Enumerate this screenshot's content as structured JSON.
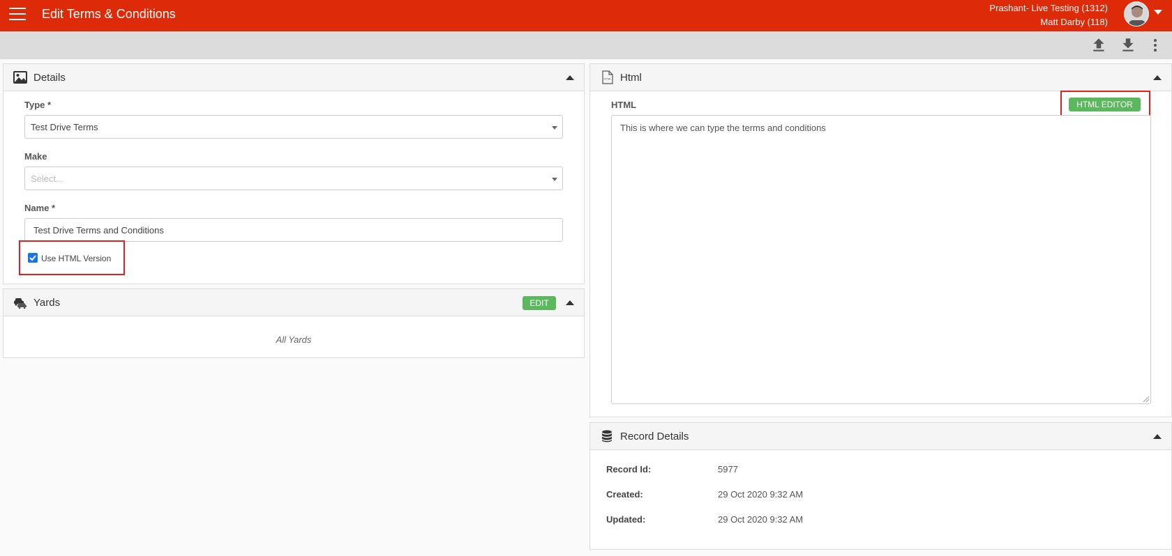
{
  "header": {
    "title": "Edit Terms & Conditions",
    "user_line1": "Prashant- Live Testing (1312)",
    "user_line2": "Matt Darby (118)"
  },
  "toolbar": {
    "icons": [
      "upload-icon",
      "download-icon",
      "more-vert-icon"
    ]
  },
  "details": {
    "title": "Details",
    "type_label": "Type *",
    "type_value": "Test Drive Terms",
    "make_label": "Make",
    "make_placeholder": "Select...",
    "name_label": "Name *",
    "name_value": "Test Drive Terms and Conditions",
    "use_html_label": "Use HTML Version",
    "use_html_checked": true
  },
  "yards": {
    "title": "Yards",
    "edit_label": "EDIT",
    "all_yards": "All Yards"
  },
  "html_panel": {
    "title": "Html",
    "html_label": "HTML",
    "editor_button": "HTML EDITOR",
    "content": "This is where we can type the terms and conditions"
  },
  "record": {
    "title": "Record Details",
    "id_label": "Record Id:",
    "id_value": "5977",
    "created_label": "Created:",
    "created_value": "29 Oct 2020 9:32 AM",
    "updated_label": "Updated:",
    "updated_value": "29 Oct 2020 9:32 AM"
  },
  "colors": {
    "topbar": "#dd2a08",
    "success": "#5cb85c",
    "highlight": "#e02020",
    "checkbox": "#1a73e8"
  }
}
